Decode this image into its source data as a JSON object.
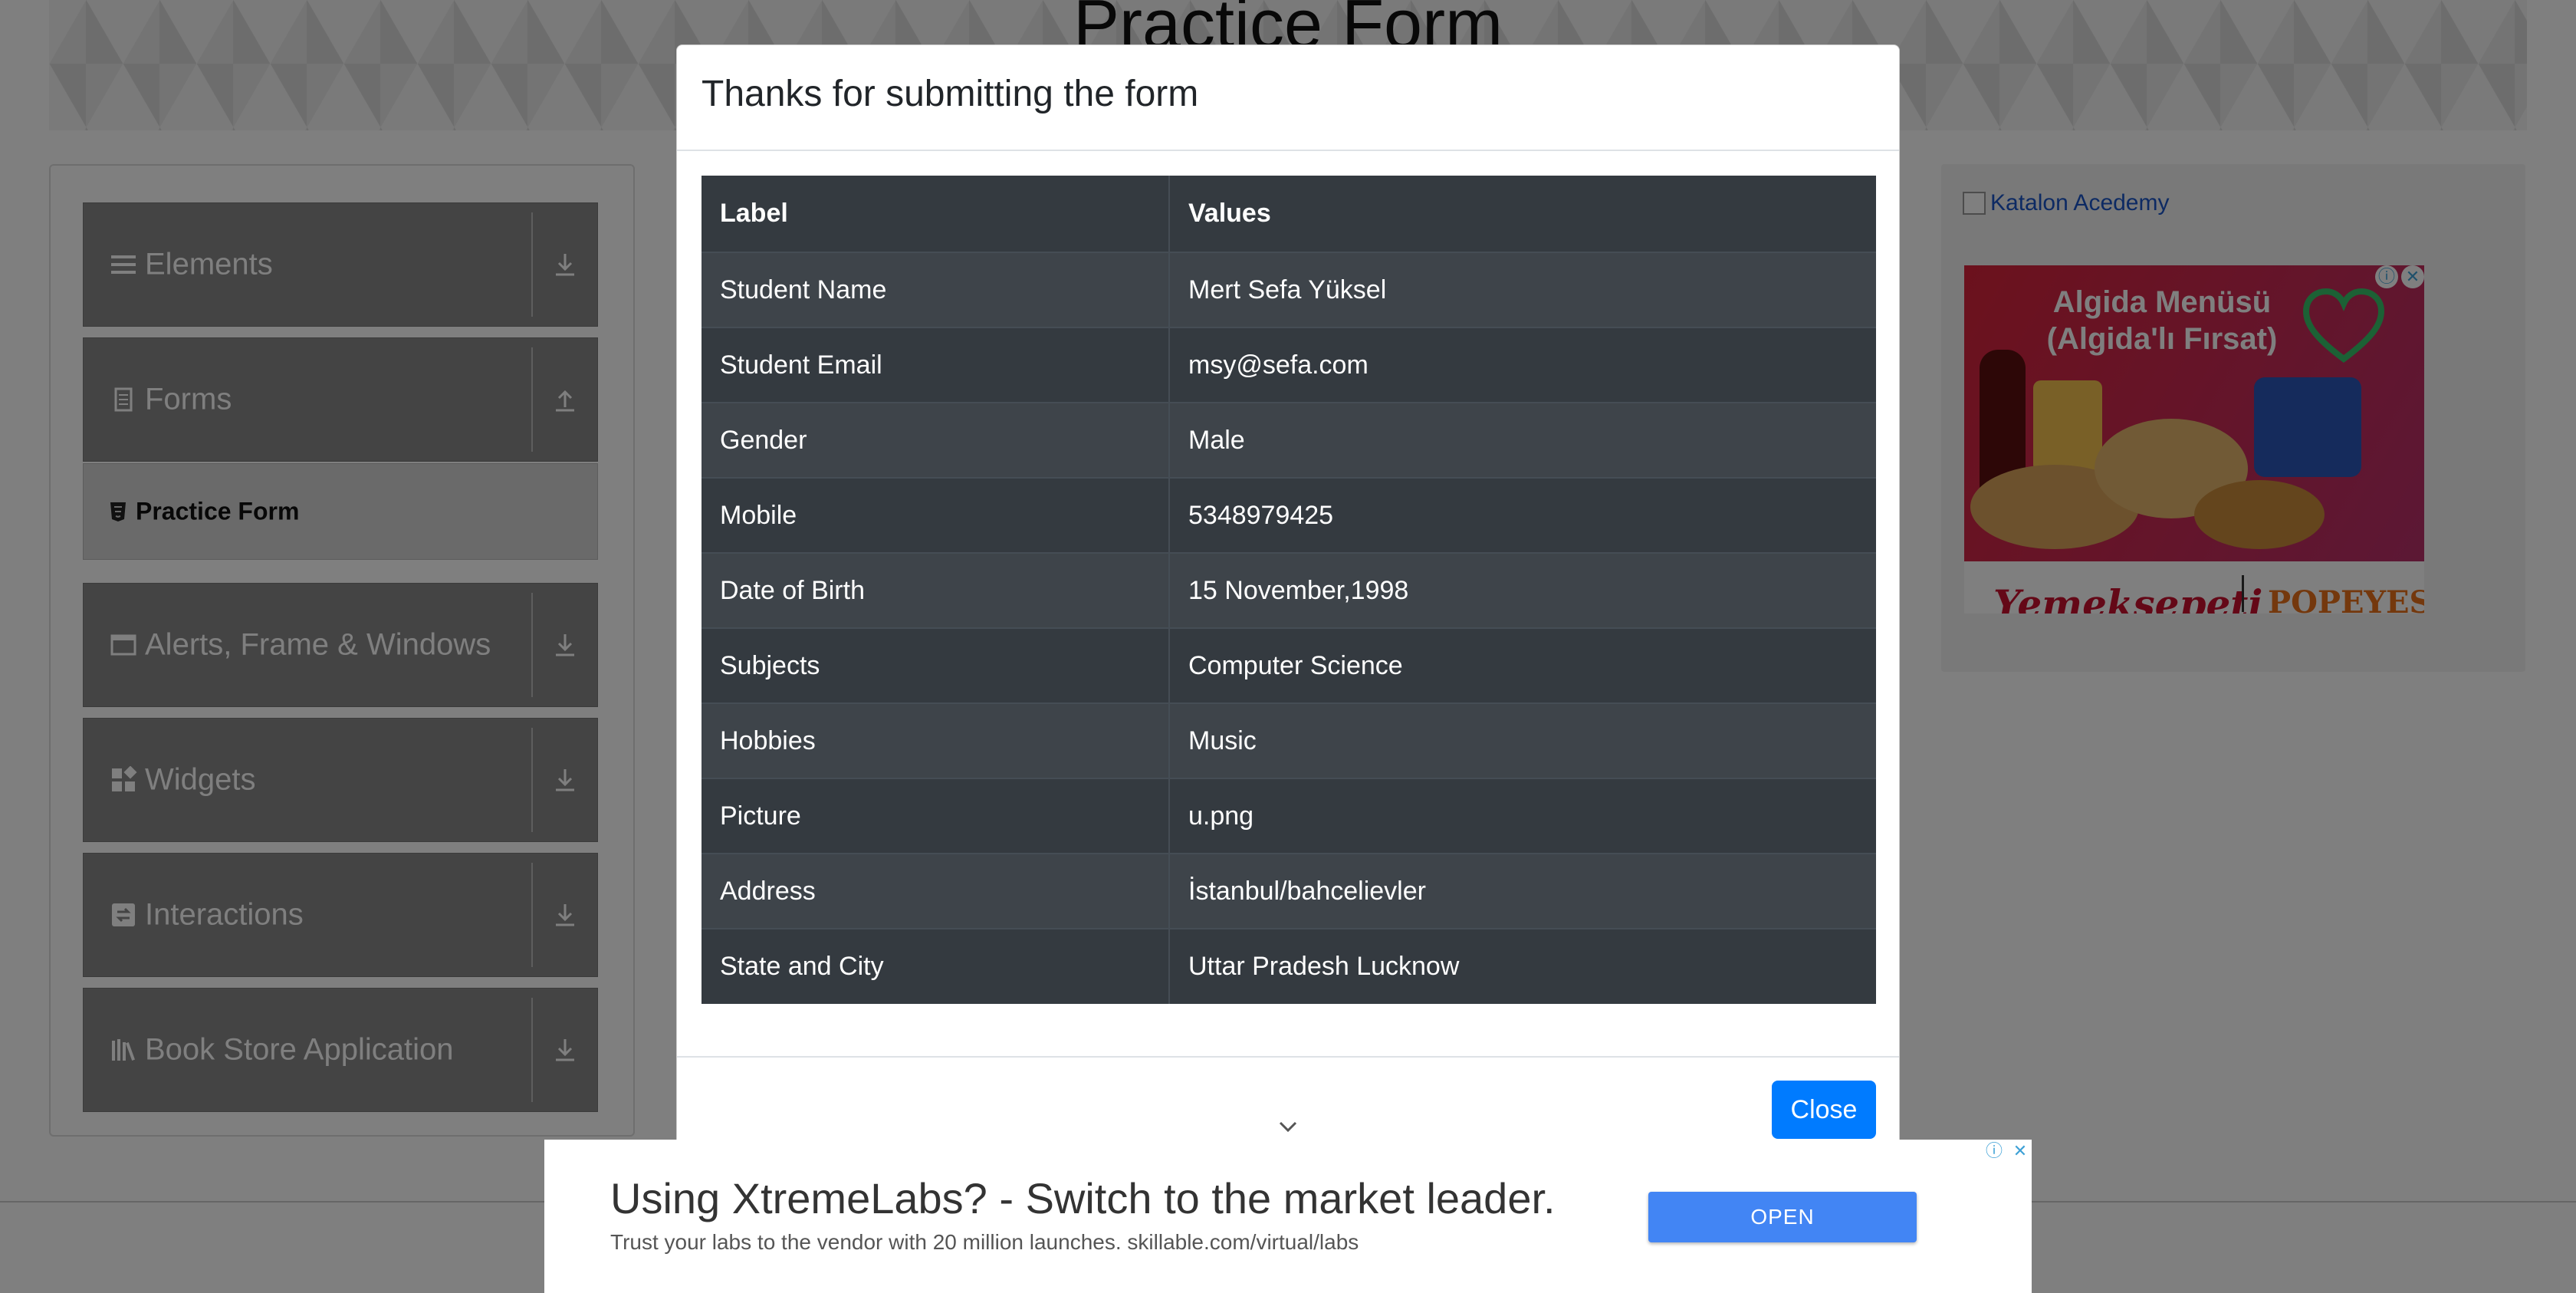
{
  "page": {
    "title": "Practice Form"
  },
  "sidebar": {
    "groups": [
      {
        "label": "Elements",
        "icon": "list-icon",
        "arrow": "download-arrow-icon"
      },
      {
        "label": "Forms",
        "icon": "document-icon",
        "arrow": "upload-arrow-icon"
      },
      {
        "label": "Alerts, Frame & Windows",
        "icon": "window-icon",
        "arrow": "download-arrow-icon"
      },
      {
        "label": "Widgets",
        "icon": "widgets-icon",
        "arrow": "download-arrow-icon"
      },
      {
        "label": "Interactions",
        "icon": "interactions-icon",
        "arrow": "download-arrow-icon"
      },
      {
        "label": "Book Store Application",
        "icon": "books-icon",
        "arrow": "download-arrow-icon"
      }
    ],
    "active_item": {
      "label": "Practice Form",
      "icon": "html5-icon"
    }
  },
  "right_ad": {
    "link_text": "Katalon Acedemy",
    "banner_headline": "Algida Menüsü (Algida'lı Fırsat)",
    "brand_left": "Yemeksepeti",
    "brand_right": "POPEYES"
  },
  "modal": {
    "title": "Thanks for submitting the form",
    "columns": [
      "Label",
      "Values"
    ],
    "rows": [
      {
        "label": "Student Name",
        "value": "Mert Sefa Yüksel"
      },
      {
        "label": "Student Email",
        "value": "msy@sefa.com"
      },
      {
        "label": "Gender",
        "value": "Male"
      },
      {
        "label": "Mobile",
        "value": "5348979425"
      },
      {
        "label": "Date of Birth",
        "value": "15 November,1998"
      },
      {
        "label": "Subjects",
        "value": "Computer Science"
      },
      {
        "label": "Hobbies",
        "value": "Music"
      },
      {
        "label": "Picture",
        "value": "u.png"
      },
      {
        "label": "Address",
        "value": "İstanbul/bahcelievler"
      },
      {
        "label": "State and City",
        "value": "Uttar Pradesh Lucknow"
      }
    ],
    "close_label": "Close"
  },
  "bottom_ad": {
    "headline": "Using XtremeLabs? - Switch to the market leader.",
    "subline": "Trust your labs to the vendor with 20 million launches. skillable.com/virtual/labs",
    "button_label": "OPEN"
  },
  "colors": {
    "primary": "#007bff",
    "table_dark": "#343a40",
    "table_stripe": "#3e444a",
    "ad_button": "#4285f4"
  }
}
